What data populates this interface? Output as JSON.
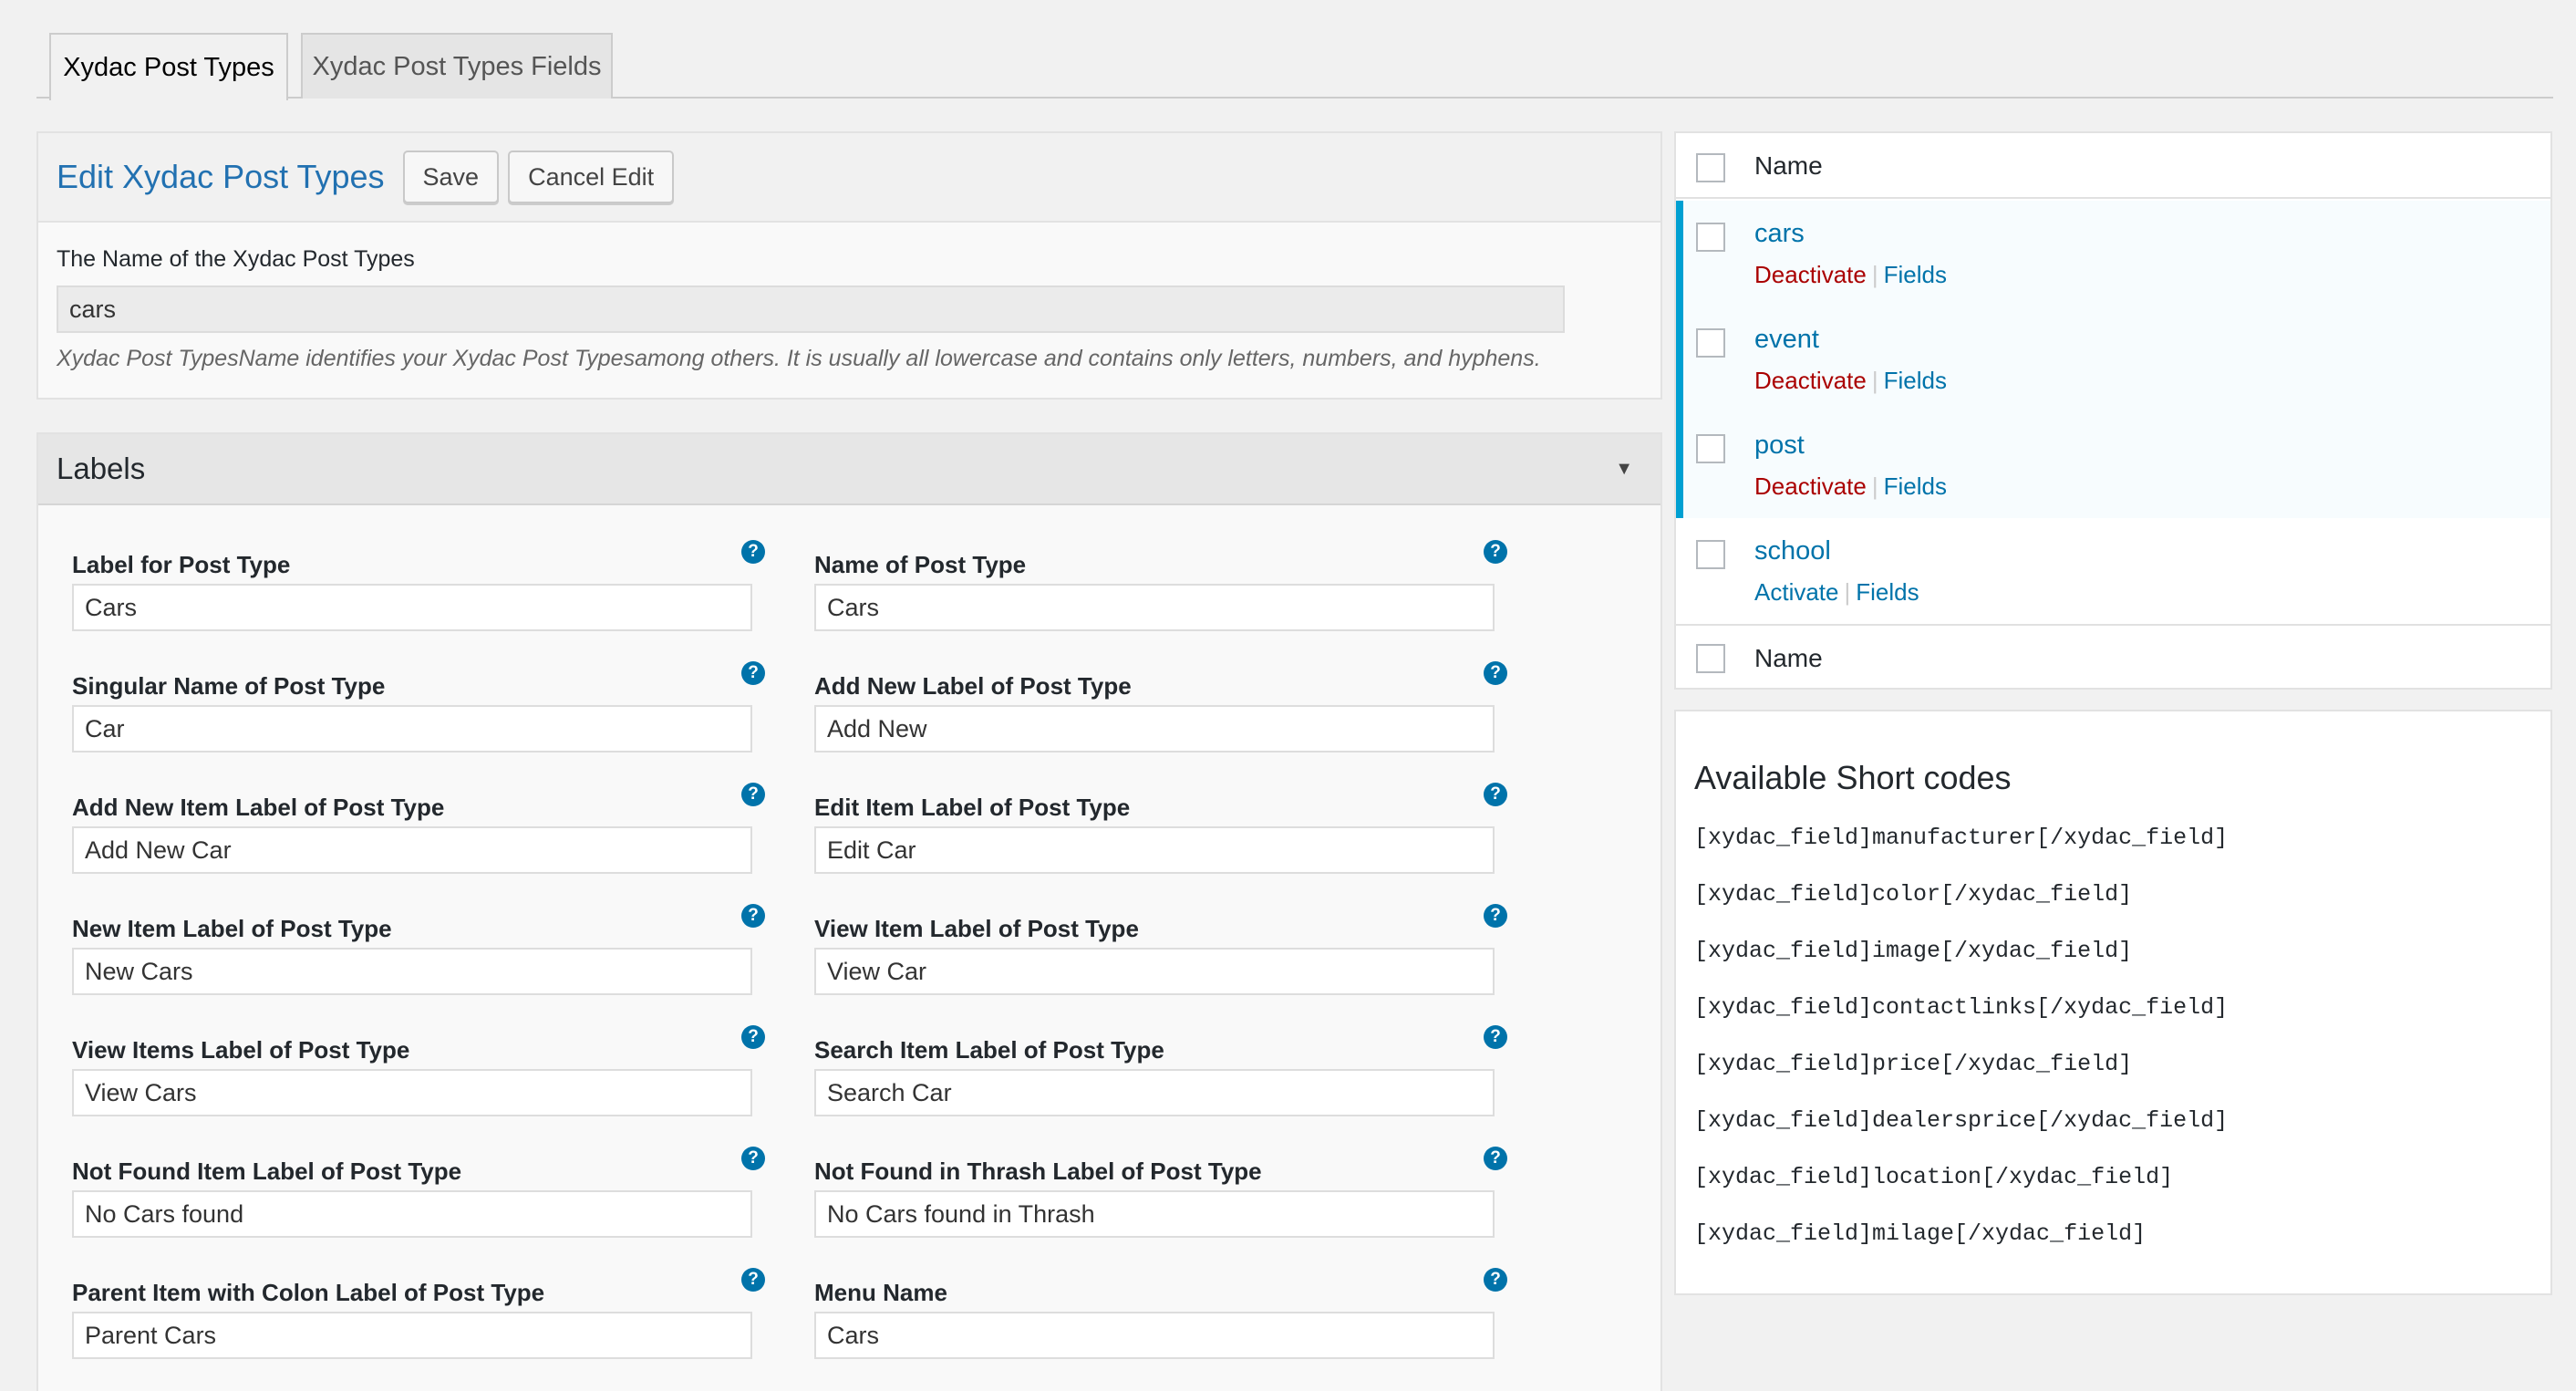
{
  "tabs": [
    {
      "label": "Xydac Post Types",
      "active": true
    },
    {
      "label": "Xydac Post Types Fields",
      "active": false
    }
  ],
  "edit": {
    "title": "Edit Xydac Post Types",
    "save_label": "Save",
    "cancel_label": "Cancel Edit",
    "name_label": "The Name of the Xydac Post Types",
    "name_value": "cars",
    "hint": "Xydac Post TypesName identifies your Xydac Post Typesamong others. It is usually all lowercase and contains only letters, numbers, and hyphens."
  },
  "labels": {
    "title": "Labels",
    "caret": "▼",
    "fields": [
      {
        "label": "Label for Post Type",
        "value": "Cars"
      },
      {
        "label": "Name of Post Type",
        "value": "Cars"
      },
      {
        "label": "Singular Name of Post Type",
        "value": "Car"
      },
      {
        "label": "Add New Label of Post Type",
        "value": "Add New"
      },
      {
        "label": "Add New Item Label of Post Type",
        "value": "Add New Car"
      },
      {
        "label": "Edit Item Label of Post Type",
        "value": "Edit Car"
      },
      {
        "label": "New Item Label of Post Type",
        "value": "New Cars"
      },
      {
        "label": "View Item Label of Post Type",
        "value": "View Car"
      },
      {
        "label": "View Items Label of Post Type",
        "value": "View Cars"
      },
      {
        "label": "Search Item Label of Post Type",
        "value": "Search Car"
      },
      {
        "label": "Not Found Item Label of Post Type",
        "value": "No Cars found"
      },
      {
        "label": "Not Found in Thrash Label of Post Type",
        "value": "No Cars found in Thrash"
      },
      {
        "label": "Parent Item with Colon Label of Post Type",
        "value": "Parent Cars"
      },
      {
        "label": "Menu Name",
        "value": "Cars"
      }
    ],
    "help_glyph": "?"
  },
  "list": {
    "header": "Name",
    "footer": "Name",
    "separator": "|",
    "items": [
      {
        "name": "cars",
        "action": "Deactivate",
        "fields": "Fields",
        "active": true
      },
      {
        "name": "event",
        "action": "Deactivate",
        "fields": "Fields",
        "active": true
      },
      {
        "name": "post",
        "action": "Deactivate",
        "fields": "Fields",
        "active": true
      },
      {
        "name": "school",
        "action": "Activate",
        "fields": "Fields",
        "active": false
      }
    ]
  },
  "shortcodes": {
    "title": "Available Short codes",
    "codes": [
      "[xydac_field]manufacturer[/xydac_field]",
      "[xydac_field]color[/xydac_field]",
      "[xydac_field]image[/xydac_field]",
      "[xydac_field]contactlinks[/xydac_field]",
      "[xydac_field]price[/xydac_field]",
      "[xydac_field]dealersprice[/xydac_field]",
      "[xydac_field]location[/xydac_field]",
      "[xydac_field]milage[/xydac_field]"
    ]
  },
  "colors": {
    "accent": "#0073aa",
    "active_bar": "#00a0d2",
    "deactivate": "#aa0000",
    "active_row_bg": "#f7fcfe"
  }
}
